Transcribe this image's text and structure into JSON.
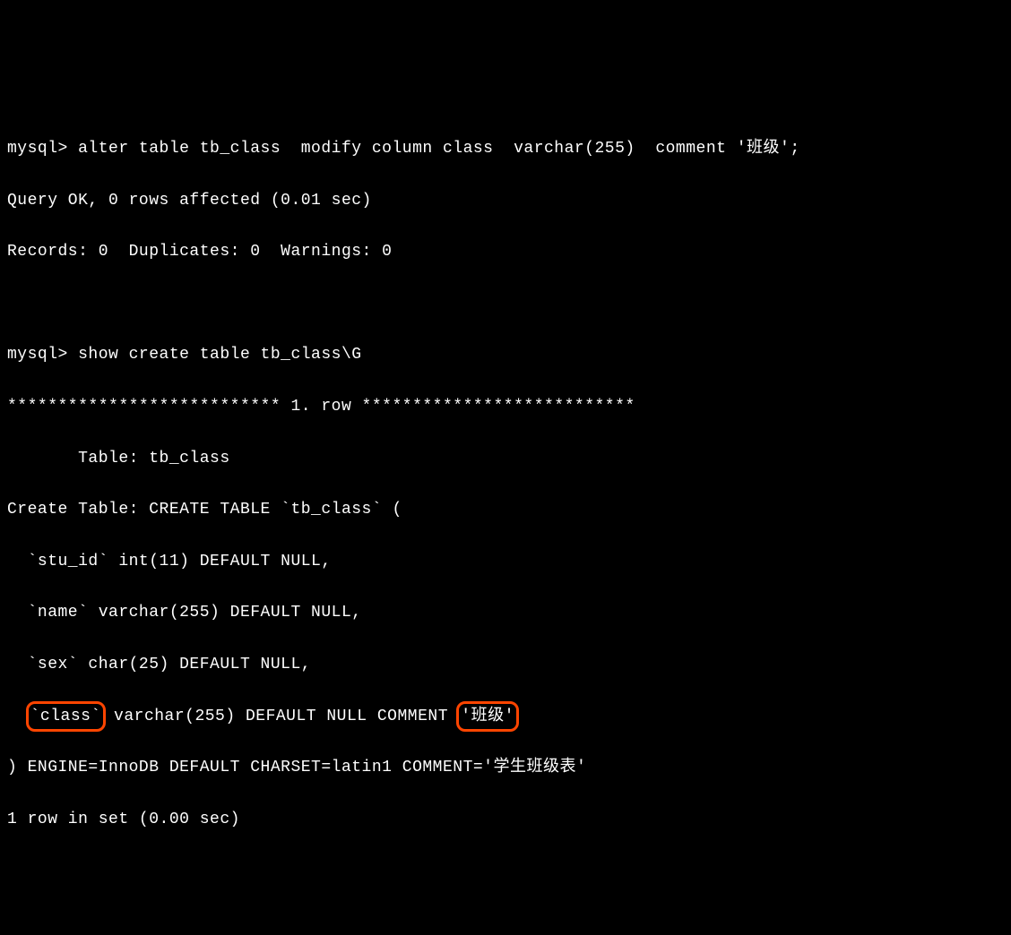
{
  "terminal": {
    "lines": [
      {
        "text": "mysql> alter table tb_class  modify column class  varchar(255)  comment '班级';"
      },
      {
        "text": "Query OK, 0 rows affected (0.01 sec)"
      },
      {
        "text": "Records: 0  Duplicates: 0  Warnings: 0"
      },
      {
        "text": ""
      },
      {
        "text": "mysql> show create table tb_class\\G"
      },
      {
        "text": "*************************** 1. row ***************************"
      },
      {
        "text": "       Table: tb_class"
      },
      {
        "text": "Create Table: CREATE TABLE `tb_class` ("
      },
      {
        "text": "  `stu_id` int(11) DEFAULT NULL,"
      },
      {
        "text": "  `name` varchar(255) DEFAULT NULL,"
      },
      {
        "text": "  `sex` char(25) DEFAULT NULL,"
      },
      {
        "segments": [
          {
            "text": "  "
          },
          {
            "text": "`class`",
            "highlight": true
          },
          {
            "text": " varchar(255) DEFAULT NULL COMMENT "
          },
          {
            "text": "'班级'",
            "highlight": true
          }
        ]
      },
      {
        "text": ") ENGINE=InnoDB DEFAULT CHARSET=latin1 COMMENT='学生班级表'"
      },
      {
        "text": "1 row in set (0.00 sec)"
      }
    ]
  }
}
